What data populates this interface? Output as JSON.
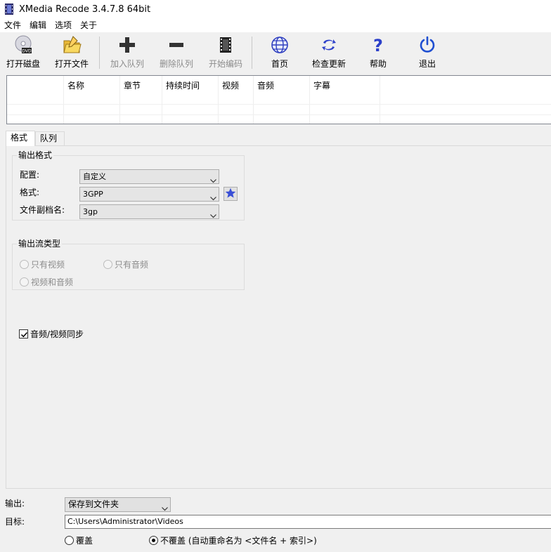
{
  "window": {
    "title": "XMedia Recode 3.4.7.8 64bit"
  },
  "menu": {
    "items": [
      "文件",
      "编辑",
      "选项",
      "关于"
    ]
  },
  "toolbar": {
    "open_disc": "打开磁盘",
    "open_file": "打开文件",
    "add_queue": "加入队列",
    "remove_queue": "删除队列",
    "start_encode": "开始编码",
    "home": "首页",
    "check_update": "检查更新",
    "help": "帮助",
    "exit": "退出"
  },
  "file_list": {
    "columns": [
      "",
      "名称",
      "章节",
      "持续时间",
      "视频",
      "音频",
      "字幕"
    ]
  },
  "tabs": {
    "format": "格式",
    "queue": "队列"
  },
  "output_format": {
    "group_title": "输出格式",
    "profile_label": "配置:",
    "profile_value": "自定义",
    "format_label": "格式:",
    "format_value": "3GPP",
    "extension_label": "文件副档名:",
    "extension_value": "3gp"
  },
  "stream_type": {
    "group_title": "输出流类型",
    "video_only": "只有视频",
    "audio_only": "只有音频",
    "video_audio": "视频和音频"
  },
  "sync": {
    "label": "音频/视频同步",
    "checked": true
  },
  "output": {
    "label": "输出:",
    "value": "保存到文件夹",
    "target_label": "目标:",
    "target_value": "C:\\Users\\Administrator\\Videos",
    "overwrite_label": "覆盖",
    "no_overwrite_label": "不覆盖 (自动重命名为 <文件名 + 索引>)",
    "selected": "no_overwrite"
  },
  "colors": {
    "accent_star": "#3a4fd6",
    "help_blue": "#2b3fc9",
    "exit_blue": "#1f4fd1"
  }
}
